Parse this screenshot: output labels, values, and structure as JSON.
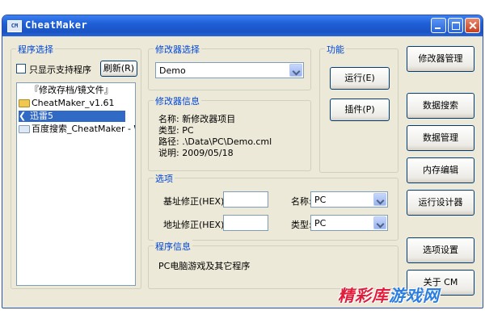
{
  "window": {
    "title": "CheatMaker",
    "icon_text": "CM"
  },
  "left": {
    "group_label": "程序选择",
    "checkbox_label": "只显示支持程序",
    "refresh_label": "刷新(R)",
    "tree_items": [
      {
        "label": "『修改存档/镜文件』"
      },
      {
        "label": "CheatMaker_v1.61"
      },
      {
        "label": "迅雷5"
      },
      {
        "label": "百度搜索_CheatMaker - W"
      }
    ]
  },
  "editor_select": {
    "group_label": "修改器选择",
    "value": "Demo"
  },
  "editor_info": {
    "group_label": "修改器信息",
    "name": "名称: 新修改器项目",
    "type": "类型: PC",
    "path": "路径: .\\Data\\PC\\Demo.cml",
    "desc": "说明: 2009/05/18"
  },
  "function": {
    "group_label": "功能",
    "run_label": "运行(E)",
    "plugin_label": "插件(P)"
  },
  "options": {
    "group_label": "选项",
    "base_label": "基址修正(HEX):",
    "addr_label": "地址修正(HEX):",
    "name_label": "名称:",
    "name_value": "PC",
    "type_label": "类型:",
    "type_value": "PC"
  },
  "program_info": {
    "group_label": "程序信息",
    "text": "PC电脑游戏及其它程序"
  },
  "right_buttons": {
    "editor_mgmt": "修改器管理",
    "data_search": "数据搜索",
    "data_mgmt": "数据管理",
    "memory_edit": "内存编辑",
    "run_designer": "运行设计器",
    "options_settings": "选项设置",
    "about": "关于 CM"
  },
  "watermark": {
    "main": "精彩库",
    "tail": "游戏网"
  }
}
